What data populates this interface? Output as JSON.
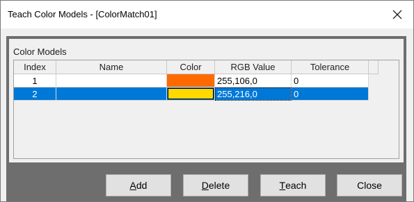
{
  "window": {
    "title": "Teach Color Models - [ColorMatch01]",
    "close_glyph": "✕"
  },
  "group": {
    "label": "Color Models"
  },
  "table": {
    "columns": [
      "Index",
      "Name",
      "Color",
      "RGB Value",
      "Tolerance"
    ],
    "rows": [
      {
        "index": "1",
        "name": "",
        "color": "#ff6a00",
        "rgb": "255,106,0",
        "tolerance": "0",
        "selected": false
      },
      {
        "index": "2",
        "name": "",
        "color": "#ffd800",
        "rgb": "255,216,0",
        "tolerance": "0",
        "selected": true
      }
    ]
  },
  "buttons": {
    "add": {
      "accel": "A",
      "rest": "dd"
    },
    "delete": {
      "accel": "D",
      "rest": "elete"
    },
    "teach": {
      "accel": "T",
      "rest": "each"
    },
    "close": {
      "label": "Close"
    }
  },
  "colors": {
    "selection": "#0078d7",
    "frame": "#6e6e6e",
    "dialog_bg": "#f0f0f0"
  }
}
